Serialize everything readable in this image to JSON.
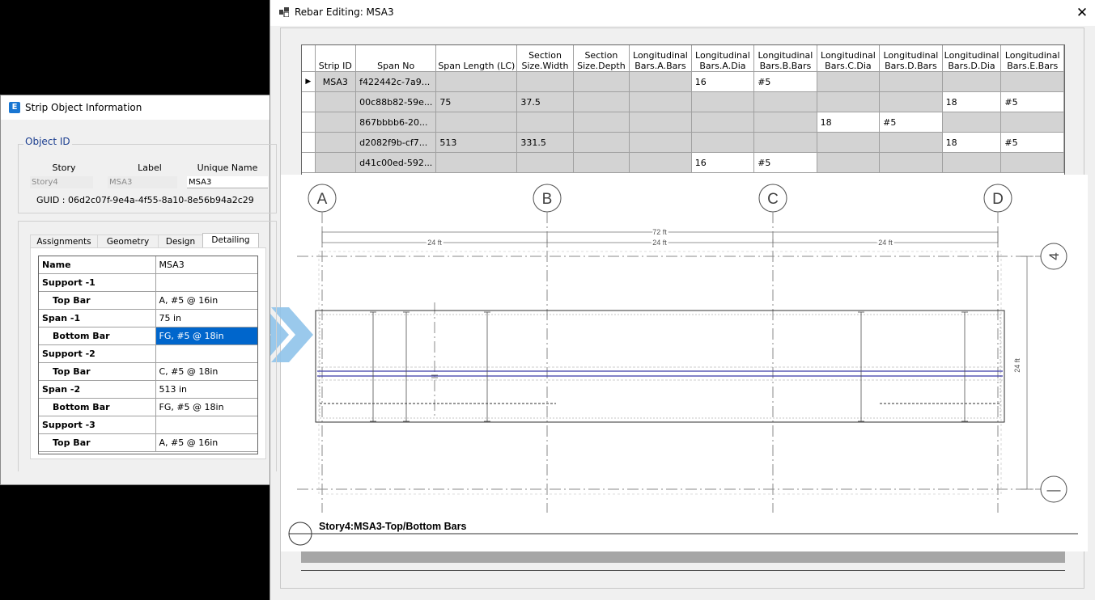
{
  "rebar_window": {
    "title": "Rebar Editing: MSA3",
    "columns": [
      "",
      "Strip ID",
      "Span No",
      "Span Length (LC)",
      "Section Size.Width",
      "Section Size.Depth",
      "Longitudinal Bars.A.Bars",
      "Longitudinal Bars.A.Dia",
      "Longitudinal Bars.B.Bars",
      "Longitudinal Bars.C.Dia",
      "Longitudinal Bars.D.Bars",
      "Longitudinal Bars.D.Dia",
      "Longitudinal Bars.E.Bars"
    ],
    "column_lines": [
      [
        "",
        ""
      ],
      [
        "Strip ID",
        ""
      ],
      [
        "Span No",
        ""
      ],
      [
        "Span Length (LC)",
        ""
      ],
      [
        "Section",
        "Size.Width"
      ],
      [
        "Section",
        "Size.Depth"
      ],
      [
        "Longitudinal",
        "Bars.A.Bars"
      ],
      [
        "Longitudinal",
        "Bars.A.Dia"
      ],
      [
        "Longitudinal",
        "Bars.B.Bars"
      ],
      [
        "Longitudinal",
        "Bars.C.Dia"
      ],
      [
        "Longitudinal",
        "Bars.D.Bars"
      ],
      [
        "Longitudinal",
        "Bars.D.Dia"
      ],
      [
        "Longitudinal",
        "Bars.E.Bars"
      ]
    ],
    "rows": [
      [
        "▶",
        "MSA3",
        "f422442c-7a9...",
        "",
        "",
        "",
        "",
        "16",
        "#5",
        "",
        "",
        "",
        ""
      ],
      [
        "",
        "",
        "00c88b82-59e...",
        "75",
        "37.5",
        "",
        "",
        "",
        "",
        "",
        "",
        "18",
        "#5"
      ],
      [
        "",
        "",
        "867bbbb6-20...",
        "",
        "",
        "",
        "",
        "",
        "",
        "18",
        "#5",
        "",
        ""
      ],
      [
        "",
        "",
        "d2082f9b-cf7...",
        "513",
        "331.5",
        "",
        "",
        "",
        "",
        "",
        "",
        "18",
        "#5"
      ],
      [
        "",
        "",
        "d41c00ed-592...",
        "",
        "",
        "",
        "",
        "16",
        "#5",
        "",
        "",
        "",
        ""
      ]
    ],
    "drawing": {
      "grid_labels": [
        "A",
        "B",
        "C",
        "D"
      ],
      "side_labels": [
        "4",
        "—"
      ],
      "overall_dim": "72 ft",
      "span_dims": [
        "24 ft",
        "24 ft",
        "24 ft"
      ],
      "height_dim": "24 ft",
      "caption": "Story4:MSA3-Top/Bottom Bars"
    }
  },
  "strip_window": {
    "title": "Strip Object Information",
    "icon_letter": "E",
    "object_id_legend": "Object ID",
    "headers": {
      "story": "Story",
      "label": "Label",
      "unique_name": "Unique Name"
    },
    "values": {
      "story": "Story4",
      "label": "MSA3",
      "unique_name": "MSA3"
    },
    "guid": "GUID : 06d2c07f-9e4a-4f55-8a10-8e56b94a2c29",
    "tabs": [
      "Assignments",
      "Geometry",
      "Design",
      "Detailing"
    ],
    "active_tab": "Detailing",
    "detailing": [
      {
        "key": "Name",
        "value": "MSA3"
      },
      {
        "key": "Support -1",
        "value": ""
      },
      {
        "key": "Top Bar",
        "value": "A, #5 @ 16in"
      },
      {
        "key": "Span -1",
        "value": "75 in"
      },
      {
        "key": "Bottom Bar",
        "value": "FG, #5 @ 18in"
      },
      {
        "key": "Support -2",
        "value": ""
      },
      {
        "key": "Top Bar",
        "value": "C, #5 @ 18in"
      },
      {
        "key": "Span -2",
        "value": "513 in"
      },
      {
        "key": "Bottom Bar",
        "value": "FG, #5 @ 18in"
      },
      {
        "key": "Support -3",
        "value": ""
      },
      {
        "key": "Top Bar",
        "value": "A, #5 @ 16in"
      }
    ]
  },
  "colors": {
    "selection": "#0066cc",
    "legend_text": "#1a3d8f",
    "arrow": "#8fc3ea",
    "rebar_line": "#3a3aa8"
  }
}
